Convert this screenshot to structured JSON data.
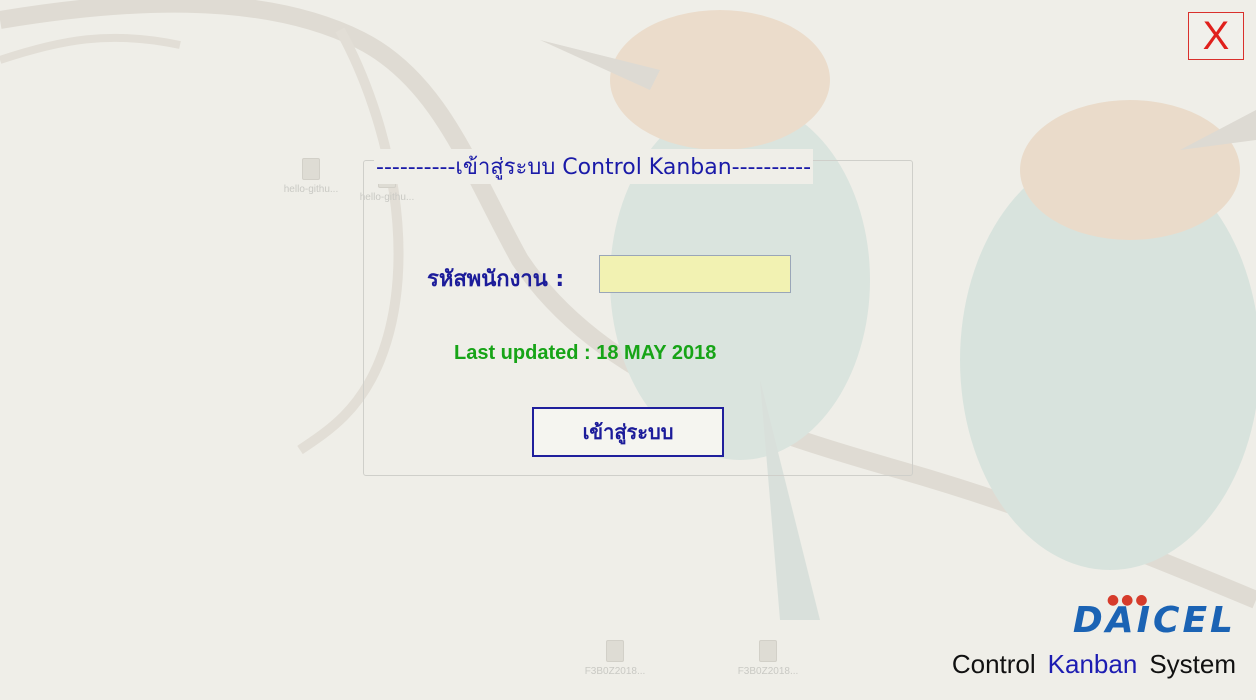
{
  "window": {
    "close_label": "X"
  },
  "login": {
    "legend": "----------เข้าสู่ระบบ Control Kanban----------",
    "employee_label": "รหัสพนักงาน :",
    "employee_value": "",
    "last_updated": "Last updated : 18 MAY 2018",
    "login_button": "เข้าสู่ระบบ"
  },
  "brand": {
    "logo_text": "DAICEL",
    "system_word1": "Control",
    "system_word2": "Kanban",
    "system_word3": "System"
  },
  "desktop": {
    "icons": [
      {
        "label": "hello-githu..."
      },
      {
        "label": "hello-githu..."
      },
      {
        "label": "F3B0Z2018..."
      },
      {
        "label": "F3B0Z2018..."
      }
    ]
  },
  "colors": {
    "title_blue": "#1a1aa8",
    "updated_green": "#17a417",
    "close_red": "#e0201c",
    "input_bg": "#f2f2b2",
    "brand_blue": "#1b63b4"
  }
}
